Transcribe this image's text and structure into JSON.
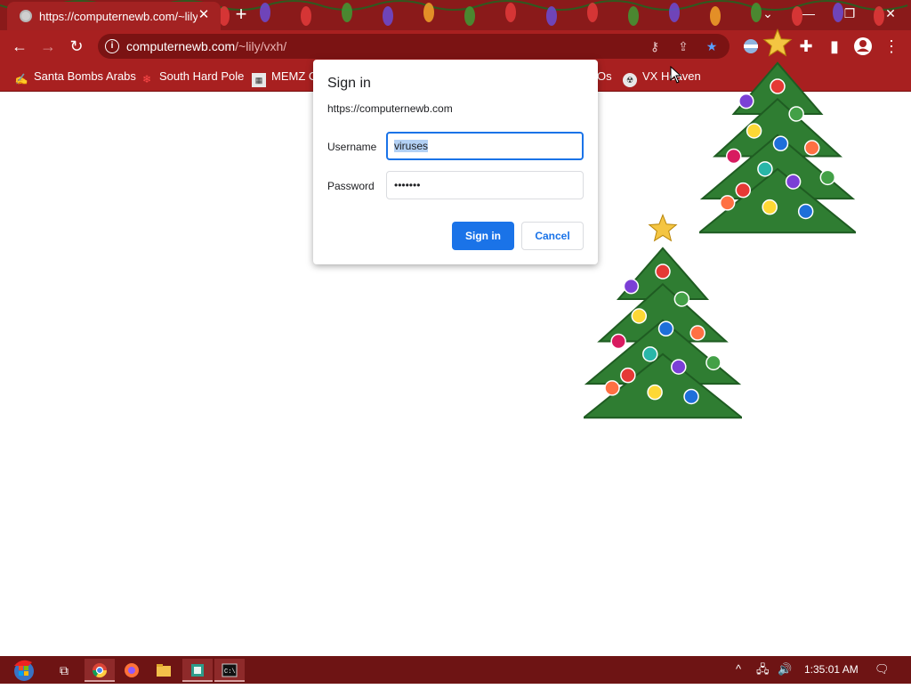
{
  "tab": {
    "title": "https://computernewb.com/~lily",
    "close": "✕"
  },
  "new_tab": "+",
  "window_controls": {
    "tabsearch": "⌄",
    "minimize": "—",
    "restore": "❐",
    "close": "✕"
  },
  "toolbar": {
    "back": "←",
    "forward": "→",
    "reload": "↻",
    "url_host": "computernewb.com",
    "url_path": "/~lily/vxh/"
  },
  "bookmarks": [
    {
      "label": "Santa Bombs Arabs",
      "icon": "santa-icon"
    },
    {
      "label": "South Hard Pole",
      "icon": "snowflake-icon"
    },
    {
      "label": "MEMZ O",
      "icon": "memz-icon"
    },
    {
      "label": "Os",
      "icon": ""
    },
    {
      "label": "VX Heaven",
      "icon": "vx-icon"
    }
  ],
  "dialog": {
    "title": "Sign in",
    "origin": "https://computernewb.com",
    "username_label": "Username",
    "username_value": "viruses",
    "password_label": "Password",
    "password_value": "•••••••",
    "signin_label": "Sign in",
    "cancel_label": "Cancel"
  },
  "taskbar": {
    "time": "1:35:01 AM"
  },
  "colors": {
    "accent": "#1a73e8",
    "chrome": "#a82020",
    "taskbar": "#6e1414"
  }
}
